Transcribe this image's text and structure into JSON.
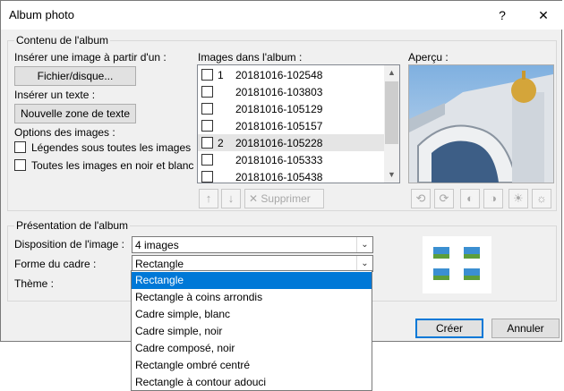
{
  "window": {
    "title": "Album photo",
    "help_glyph": "?",
    "close_glyph": "✕"
  },
  "content_group": {
    "label": "Contenu de l'album",
    "insert_from_label": "Insérer une image à partir d'un :",
    "file_disk_button": "Fichier/disque...",
    "insert_text_label": "Insérer un texte :",
    "new_text_box_button": "Nouvelle zone de texte",
    "image_options_label": "Options des images :",
    "options": [
      {
        "label": "Légendes sous toutes les images",
        "checked": false
      },
      {
        "label": "Toutes les images en noir et blanc",
        "checked": false
      }
    ],
    "album_images_label": "Images dans l'album :",
    "album_images": [
      {
        "num": "1",
        "name": "20181016-102548",
        "selected": false
      },
      {
        "num": "",
        "name": "20181016-103803",
        "selected": false
      },
      {
        "num": "",
        "name": "20181016-105129",
        "selected": false
      },
      {
        "num": "",
        "name": "20181016-105157",
        "selected": false
      },
      {
        "num": "2",
        "name": "20181016-105228",
        "selected": true
      },
      {
        "num": "",
        "name": "20181016-105333",
        "selected": false
      },
      {
        "num": "",
        "name": "20181016-105438",
        "selected": false
      }
    ],
    "delete_button": "Supprimer",
    "preview_label": "Aperçu :"
  },
  "layout_group": {
    "label": "Présentation de l'album",
    "picture_layout_label": "Disposition de l'image :",
    "picture_layout_value": "4 images",
    "frame_shape_label": "Forme du cadre :",
    "frame_shape_value": "Rectangle",
    "theme_label": "Thème :",
    "frame_options": [
      "Rectangle",
      "Rectangle à coins arrondis",
      "Cadre simple, blanc",
      "Cadre simple, noir",
      "Cadre composé, noir",
      "Rectangle ombré centré",
      "Rectangle à contour adouci"
    ],
    "frame_selected_index": 0
  },
  "footer": {
    "create_button": "Créer",
    "cancel_button": "Annuler"
  },
  "colors": {
    "accent": "#0078d7",
    "dialog_bg": "#f0f0f0",
    "selection_bg": "#e5e5e5"
  }
}
